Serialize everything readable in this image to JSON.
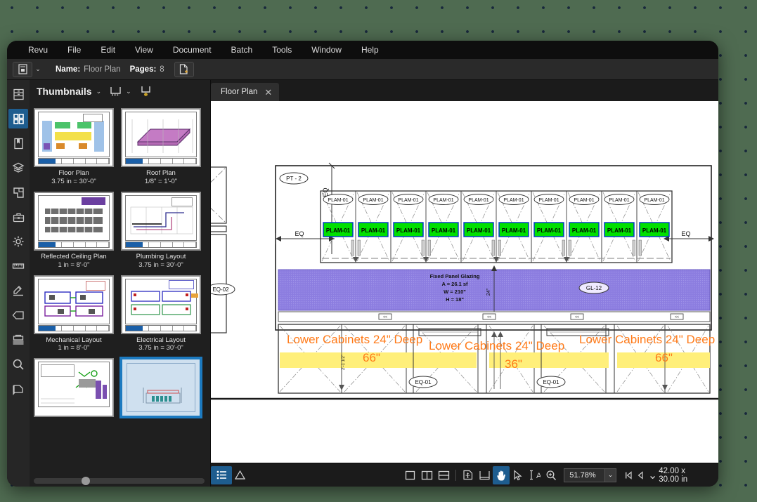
{
  "window": {
    "menu": [
      "Revu",
      "File",
      "Edit",
      "View",
      "Document",
      "Batch",
      "Tools",
      "Window",
      "Help"
    ]
  },
  "doc_toolbar": {
    "profile_icon": "document-profile-icon",
    "profile_caret": "⌄",
    "name_label": "Name:",
    "name_value": "Floor Plan",
    "pages_label": "Pages:",
    "pages_value": "8",
    "new_page_icon": "new-page-icon"
  },
  "rail": {
    "items": [
      {
        "icon": "file-cabinet-icon",
        "name": "sidebar-item-file-access",
        "active": false
      },
      {
        "icon": "thumbnails-icon",
        "name": "sidebar-item-thumbnails",
        "active": true
      },
      {
        "icon": "bookmarks-icon",
        "name": "sidebar-item-bookmarks",
        "active": false
      },
      {
        "icon": "layers-icon",
        "name": "sidebar-item-layers",
        "active": false
      },
      {
        "icon": "spaces-icon",
        "name": "sidebar-item-spaces",
        "active": false
      },
      {
        "icon": "toolbox-icon",
        "name": "sidebar-item-tool-chest",
        "active": false
      },
      {
        "icon": "gear-icon",
        "name": "sidebar-item-properties",
        "active": false
      },
      {
        "icon": "ruler-icon",
        "name": "sidebar-item-measurements",
        "active": false
      },
      {
        "icon": "stamp-icon",
        "name": "sidebar-item-signature",
        "active": false
      },
      {
        "icon": "tag-icon",
        "name": "sidebar-item-tags",
        "active": false
      },
      {
        "icon": "batch-icon",
        "name": "sidebar-item-batch",
        "active": false
      },
      {
        "icon": "search-icon",
        "name": "sidebar-item-search",
        "active": false
      },
      {
        "icon": "markup-icon",
        "name": "sidebar-item-markups",
        "active": false
      }
    ]
  },
  "thumbnails": {
    "panel_title": "Thumbnails",
    "title_caret": "⌄",
    "layout_icon": "page-layout-icon",
    "layout_caret": "⌄",
    "highlight_icon": "page-highlight-icon",
    "pages": [
      {
        "label": "Floor Plan",
        "scale": "3.75 in = 30'-0\"",
        "style": "floor",
        "selected": false
      },
      {
        "label": "Roof Plan",
        "scale": "1/8\" = 1'-0\"",
        "style": "roof",
        "selected": false
      },
      {
        "label": "Reflected Ceiling Plan",
        "scale": "1 in = 8'-0\"",
        "style": "ceiling",
        "selected": false
      },
      {
        "label": "Plumbing Layout",
        "scale": "3.75 in = 30'-0\"",
        "style": "plumbing",
        "selected": false
      },
      {
        "label": "Mechanical Layout",
        "scale": "1 in = 8'-0\"",
        "style": "mechanical",
        "selected": false
      },
      {
        "label": "Electrical Layout",
        "scale": "3.75 in = 30'-0\"",
        "style": "electrical",
        "selected": false
      },
      {
        "label": "",
        "scale": "",
        "style": "schedule",
        "selected": false
      },
      {
        "label": "",
        "scale": "",
        "style": "elevation",
        "selected": true
      }
    ]
  },
  "tabs": [
    {
      "label": "Floor Plan",
      "close_icon": "close-icon",
      "active": true
    }
  ],
  "statusbar": {
    "list_icon": "markup-list-icon",
    "warning_icon": "warning-triangle-icon",
    "view_buttons": [
      {
        "icon": "single-page-icon",
        "name": "view-single-page",
        "active": false
      },
      {
        "icon": "split-vertical-icon",
        "name": "view-split-vertical",
        "active": false
      },
      {
        "icon": "split-horizontal-icon",
        "name": "view-split-horizontal",
        "active": false
      }
    ],
    "fit_buttons": [
      {
        "icon": "fit-page-icon",
        "name": "fit-page-button",
        "active": false
      },
      {
        "icon": "fit-width-icon",
        "name": "fit-width-button",
        "active": false
      }
    ],
    "tool_buttons": [
      {
        "icon": "pan-hand-icon",
        "name": "pan-tool",
        "active": true
      },
      {
        "icon": "select-arrow-icon",
        "name": "select-tool",
        "active": false
      },
      {
        "icon": "text-select-icon",
        "name": "text-select-tool",
        "active": false
      },
      {
        "icon": "zoom-icon",
        "name": "zoom-tool",
        "active": false
      }
    ],
    "zoom_value": "51.78%",
    "zoom_caret": "⌄",
    "nav_first_icon": "first-page-icon",
    "nav_prev_icon": "previous-page-icon",
    "overflow_caret": "⌄",
    "page_size": "42.00 x 30.00 in"
  },
  "drawing": {
    "tags": {
      "pt2": "PT - 2",
      "eq02": "EQ-02",
      "gl12": "GL-12",
      "eq01": "EQ-01",
      "plam_callout": "PLAM-01",
      "plam_box": "PLAM-01"
    },
    "dimension_labels": {
      "eq_left": "EQ",
      "eq_top": "EQ",
      "eq_right": "EQ",
      "vert_small": "2'-1 1/2\""
    },
    "glazing_note": {
      "line1": "Fixed Panel Glazing",
      "line2": "A = 26.1 sf",
      "line3": "W = 210\"",
      "line4": "H = 18\""
    },
    "markup_text": [
      "Lower Cabinets 24\" Deep 66\"",
      "Lower Cabinets 24\" Deep 36\"",
      "Lower Cabinets 24\" Deep 66\""
    ],
    "upper_panel_count": 10,
    "colors": {
      "plam_green": "#00e000",
      "glazing_purple": "#8c7de0",
      "counter_yellow": "#ffef7a",
      "markup_orange": "#ff7a18"
    }
  }
}
